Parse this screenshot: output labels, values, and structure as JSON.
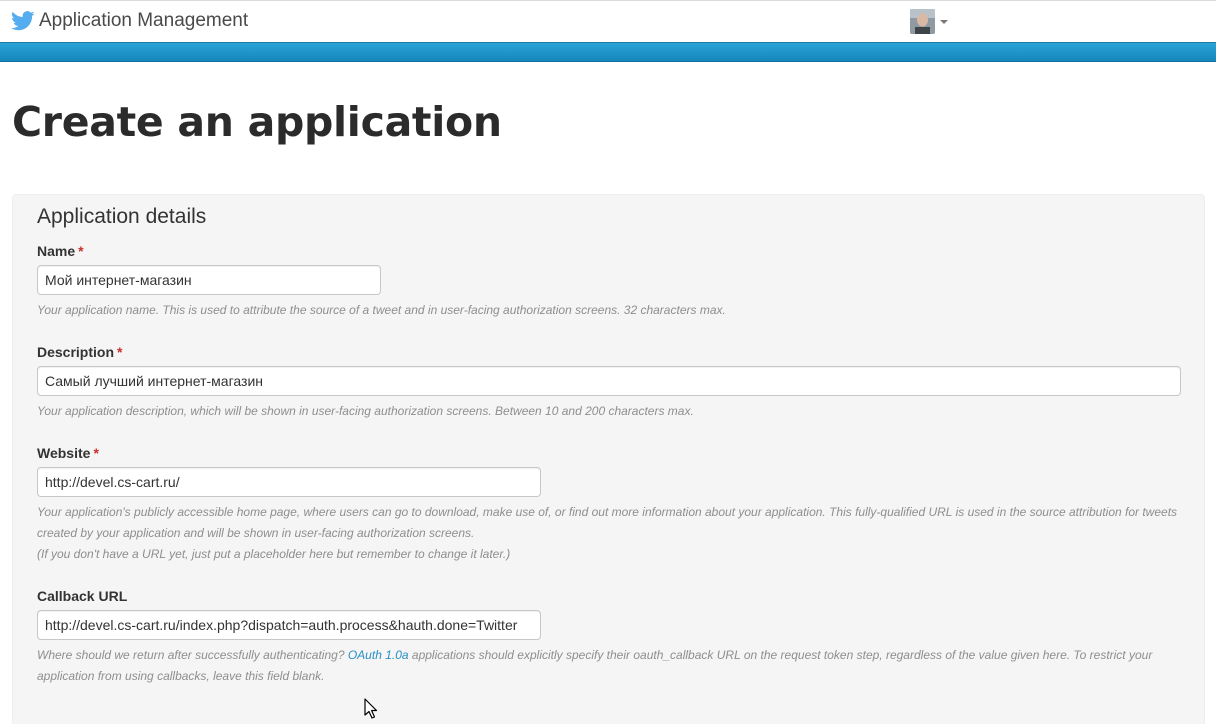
{
  "header": {
    "title": "Application Management",
    "logo_icon": "twitter-bird-icon",
    "brand_color": "#55acee",
    "band_color": "#1d8fc6"
  },
  "page": {
    "title": "Create an application"
  },
  "form": {
    "section_title": "Application details",
    "name": {
      "label": "Name",
      "required_mark": "*",
      "value": "Мой интернет-магазин",
      "help": "Your application name. This is used to attribute the source of a tweet and in user-facing authorization screens. 32 characters max."
    },
    "description": {
      "label": "Description",
      "required_mark": "*",
      "value": "Самый лучший интернет-магазин",
      "help": "Your application description, which will be shown in user-facing authorization screens. Between 10 and 200 characters max."
    },
    "website": {
      "label": "Website",
      "required_mark": "*",
      "value": "http://devel.cs-cart.ru/",
      "help_line1": "Your application's publicly accessible home page, where users can go to download, make use of, or find out more information about your application. This fully-qualified URL is used in the source attribution for tweets created by your application and will be shown in user-facing authorization screens.",
      "help_line2": "(If you don't have a URL yet, just put a placeholder here but remember to change it later.)"
    },
    "callback": {
      "label": "Callback URL",
      "value": "http://devel.cs-cart.ru/index.php?dispatch=auth.process&hauth.done=Twitter",
      "help_before": "Where should we return after successfully authenticating?",
      "help_link": "OAuth 1.0a",
      "help_after": "applications should explicitly specify their oauth_callback URL on the request token step, regardless of the value given here. To restrict your application from using callbacks, leave this field blank."
    }
  }
}
